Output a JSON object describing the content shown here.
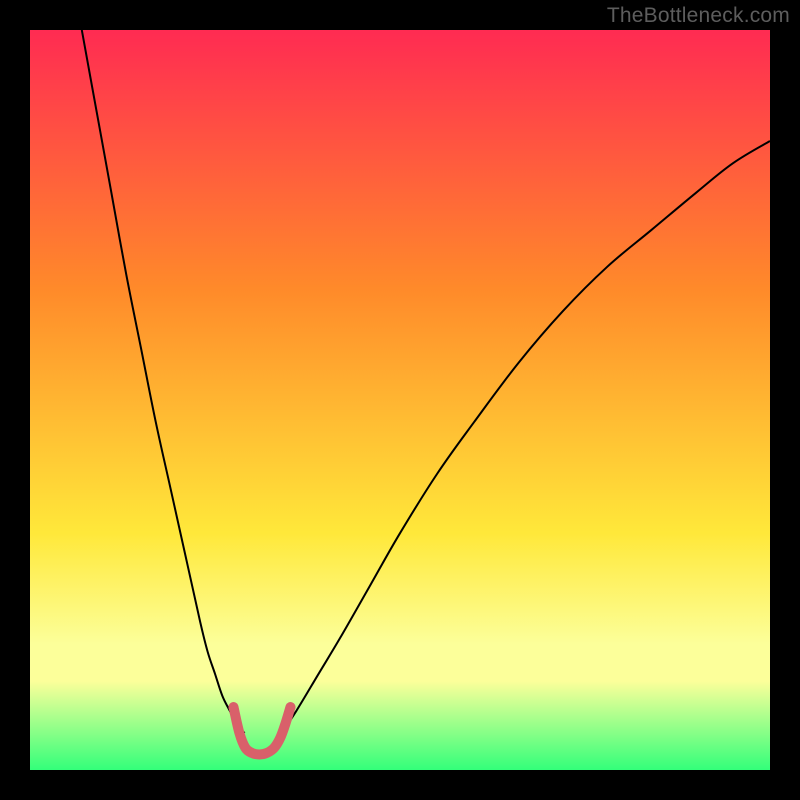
{
  "watermark": "TheBottleneck.com",
  "chart_data": {
    "type": "line",
    "title": "",
    "xlabel": "",
    "ylabel": "",
    "xlim": [
      0,
      100
    ],
    "ylim": [
      0,
      100
    ],
    "background_gradient": {
      "top": "#ff2b52",
      "mid1": "#ff8a2a",
      "mid2": "#ffe83a",
      "band": "#fcff9a",
      "bottom": "#33ff7a"
    },
    "series": [
      {
        "name": "left-branch",
        "color": "#000000",
        "width": 2,
        "x": [
          7,
          9,
          11,
          13,
          15,
          17,
          19,
          21,
          23,
          24,
          25,
          26,
          27,
          28,
          29
        ],
        "y": [
          100,
          89,
          78,
          67,
          57,
          47,
          38,
          29,
          20,
          16,
          13,
          10,
          8,
          6,
          5
        ]
      },
      {
        "name": "right-branch",
        "color": "#000000",
        "width": 2,
        "x": [
          34,
          36,
          39,
          42,
          46,
          50,
          55,
          60,
          66,
          72,
          78,
          84,
          90,
          95,
          100
        ],
        "y": [
          5,
          8,
          13,
          18,
          25,
          32,
          40,
          47,
          55,
          62,
          68,
          73,
          78,
          82,
          85
        ]
      },
      {
        "name": "valley-highlight",
        "color": "#d9606a",
        "width": 10,
        "linecap": "round",
        "x": [
          27.5,
          28.3,
          29.1,
          30.0,
          31.0,
          32.0,
          33.0,
          33.8,
          34.5,
          35.2
        ],
        "y": [
          8.5,
          5.0,
          3.0,
          2.3,
          2.1,
          2.3,
          3.0,
          4.3,
          6.2,
          8.5
        ]
      }
    ],
    "valley_dots": {
      "color": "#d9606a",
      "radius": 5,
      "points": [
        {
          "x": 27.5,
          "y": 8.5
        },
        {
          "x": 35.2,
          "y": 8.5
        }
      ]
    }
  }
}
